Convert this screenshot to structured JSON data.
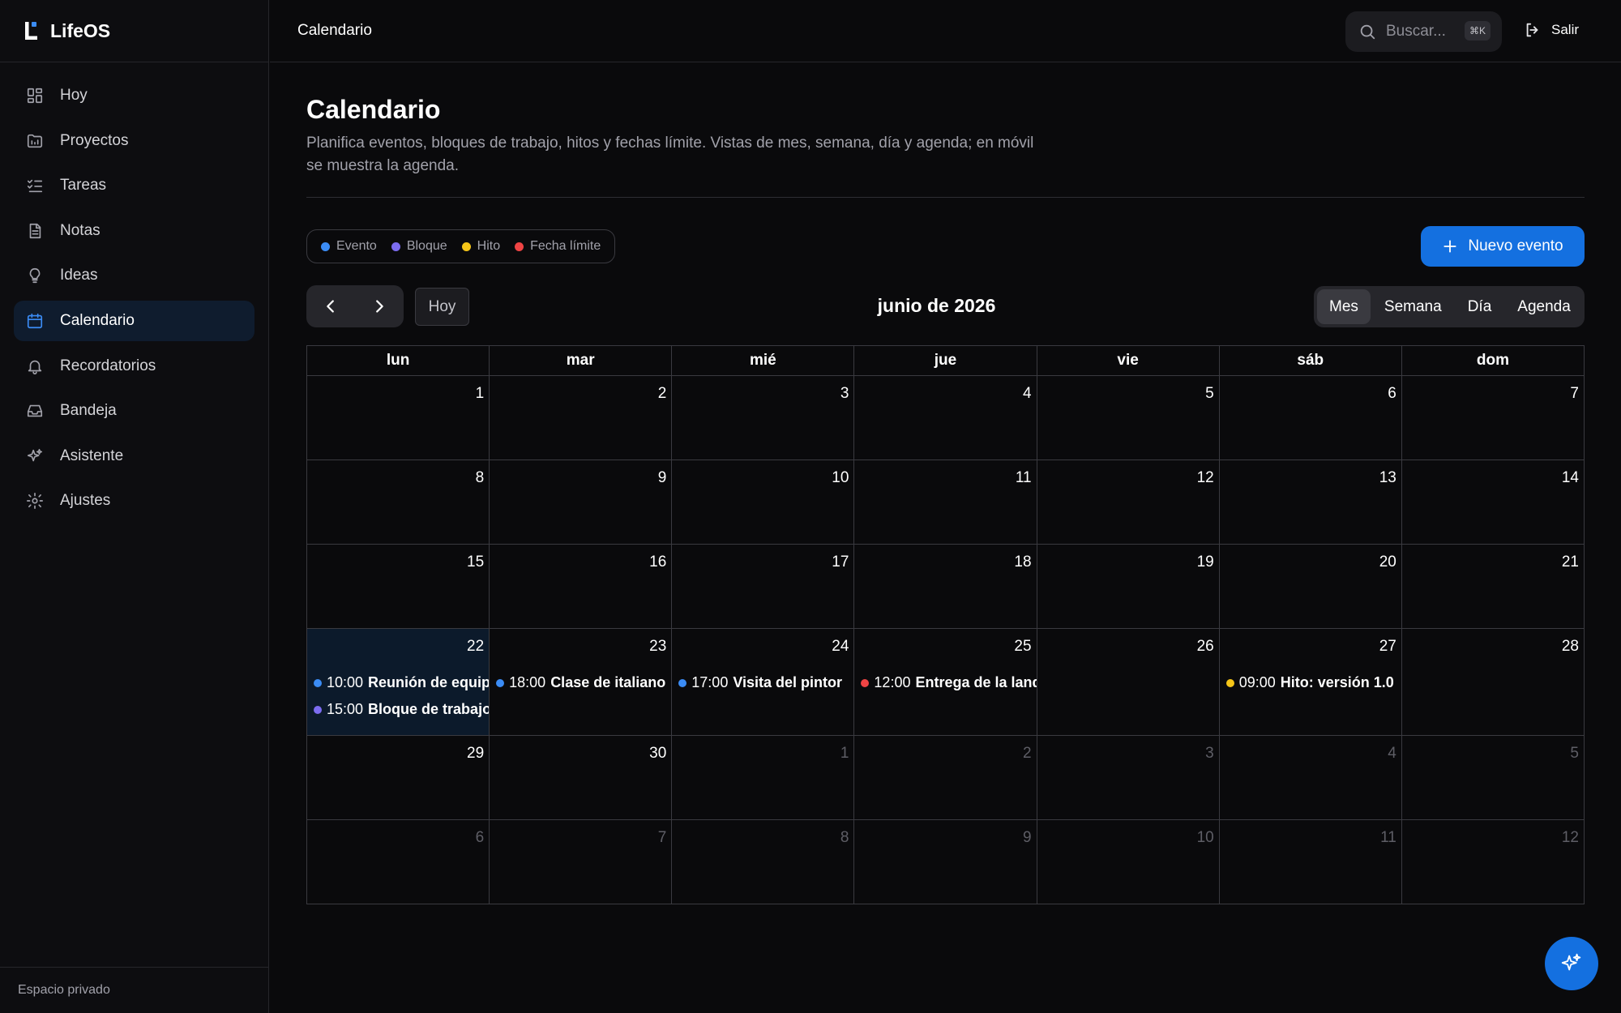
{
  "app": {
    "name": "LifeOS"
  },
  "sidebar": {
    "items": [
      {
        "label": "Hoy",
        "icon": "dashboard-icon",
        "active": false
      },
      {
        "label": "Proyectos",
        "icon": "folder-icon",
        "active": false
      },
      {
        "label": "Tareas",
        "icon": "checklist-icon",
        "active": false
      },
      {
        "label": "Notas",
        "icon": "note-icon",
        "active": false
      },
      {
        "label": "Ideas",
        "icon": "lightbulb-icon",
        "active": false
      },
      {
        "label": "Calendario",
        "icon": "calendar-icon",
        "active": true
      },
      {
        "label": "Recordatorios",
        "icon": "bell-icon",
        "active": false
      },
      {
        "label": "Bandeja",
        "icon": "inbox-icon",
        "active": false
      },
      {
        "label": "Asistente",
        "icon": "sparkles-icon",
        "active": false
      },
      {
        "label": "Ajustes",
        "icon": "gear-icon",
        "active": false
      }
    ],
    "footer": "Espacio privado"
  },
  "topbar": {
    "title": "Calendario",
    "search_placeholder": "Buscar...",
    "search_shortcut": "⌘K",
    "logout_label": "Salir"
  },
  "page": {
    "title": "Calendario",
    "description": "Planifica eventos, bloques de trabajo, hitos y fechas límite. Vistas de mes, semana, día y agenda; en móvil se muestra la agenda."
  },
  "legend": [
    {
      "label": "Evento",
      "color": "#3b8cf5"
    },
    {
      "label": "Bloque",
      "color": "#7c6cf0"
    },
    {
      "label": "Hito",
      "color": "#f5c518"
    },
    {
      "label": "Fecha límite",
      "color": "#ef4444"
    }
  ],
  "toolbar": {
    "new_event_label": "Nuevo evento",
    "today_label": "Hoy",
    "month_label": "junio de 2026",
    "views": [
      {
        "label": "Mes",
        "active": true
      },
      {
        "label": "Semana",
        "active": false
      },
      {
        "label": "Día",
        "active": false
      },
      {
        "label": "Agenda",
        "active": false
      }
    ]
  },
  "calendar": {
    "weekdays": [
      "lun",
      "mar",
      "mié",
      "jue",
      "vie",
      "sáb",
      "dom"
    ],
    "weeks": [
      [
        {
          "day": "1"
        },
        {
          "day": "2"
        },
        {
          "day": "3"
        },
        {
          "day": "4"
        },
        {
          "day": "5"
        },
        {
          "day": "6"
        },
        {
          "day": "7"
        }
      ],
      [
        {
          "day": "8"
        },
        {
          "day": "9"
        },
        {
          "day": "10"
        },
        {
          "day": "11"
        },
        {
          "day": "12"
        },
        {
          "day": "13"
        },
        {
          "day": "14"
        }
      ],
      [
        {
          "day": "15"
        },
        {
          "day": "16"
        },
        {
          "day": "17"
        },
        {
          "day": "18"
        },
        {
          "day": "19"
        },
        {
          "day": "20"
        },
        {
          "day": "21"
        }
      ],
      [
        {
          "day": "22",
          "today": true,
          "events": [
            {
              "time": "10:00",
              "title": "Reunión de equipo",
              "color": "#3b8cf5"
            },
            {
              "time": "15:00",
              "title": "Bloque de trabajo",
              "color": "#7c6cf0"
            }
          ]
        },
        {
          "day": "23",
          "events": [
            {
              "time": "18:00",
              "title": "Clase de italiano",
              "color": "#3b8cf5"
            }
          ]
        },
        {
          "day": "24",
          "events": [
            {
              "time": "17:00",
              "title": "Visita del pintor",
              "color": "#3b8cf5"
            }
          ]
        },
        {
          "day": "25",
          "events": [
            {
              "time": "12:00",
              "title": "Entrega de la landing",
              "color": "#ef4444"
            }
          ]
        },
        {
          "day": "26"
        },
        {
          "day": "27",
          "events": [
            {
              "time": "09:00",
              "title": "Hito: versión 1.0",
              "color": "#f5c518"
            }
          ]
        },
        {
          "day": "28"
        }
      ],
      [
        {
          "day": "29"
        },
        {
          "day": "30"
        },
        {
          "day": "1",
          "other": true
        },
        {
          "day": "2",
          "other": true
        },
        {
          "day": "3",
          "other": true
        },
        {
          "day": "4",
          "other": true
        },
        {
          "day": "5",
          "other": true
        }
      ],
      [
        {
          "day": "6",
          "other": true
        },
        {
          "day": "7",
          "other": true
        },
        {
          "day": "8",
          "other": true
        },
        {
          "day": "9",
          "other": true
        },
        {
          "day": "10",
          "other": true
        },
        {
          "day": "11",
          "other": true
        },
        {
          "day": "12",
          "other": true
        }
      ]
    ]
  },
  "fab": {
    "icon": "sparkles-icon"
  }
}
